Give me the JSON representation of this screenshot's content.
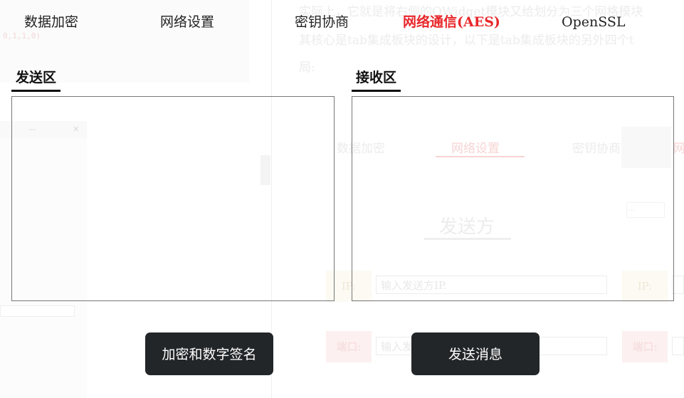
{
  "background": {
    "code_snippet": "0,1,1,0)",
    "window_controls": {
      "minimize": "—",
      "close": "✕"
    },
    "text_lines": [
      "实际上，它就是将右侧的QWidget模块又给划分为三个网格模块",
      "其核心是tab集成板块的设计，以下是tab集成板块的另外四个t",
      "局:"
    ],
    "tabs": [
      "数据加密",
      "网络设置",
      "密钥协商",
      "网"
    ],
    "sender_heading": "发送方",
    "ip_label": "IP:",
    "ip_placeholder": "输入发送方IP.",
    "port_label": "端口:",
    "port_placeholder": "输入发送方端口",
    "ip_label_right": "IP:",
    "port_label_right": "端口:",
    "small_field": "..."
  },
  "tabs": [
    {
      "label": "数据加密",
      "active": false
    },
    {
      "label": "网络设置",
      "active": false
    },
    {
      "label": "密钥协商",
      "active": false
    },
    {
      "label": "网络通信(AES)",
      "active": true
    },
    {
      "label": "OpenSSL",
      "active": false
    }
  ],
  "send_area": {
    "label": "发送区",
    "value": ""
  },
  "receive_area": {
    "label": "接收区",
    "value": ""
  },
  "buttons": {
    "encrypt_sign": "加密和数字签名",
    "send_message": "发送消息"
  },
  "colors": {
    "active_tab": "#e8272b",
    "button_bg": "#232629",
    "button_text": "#ffffff"
  }
}
